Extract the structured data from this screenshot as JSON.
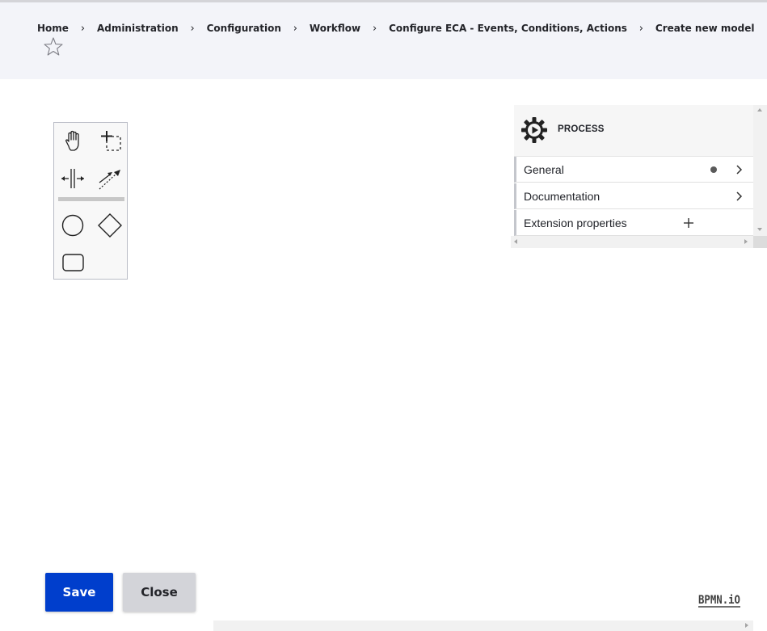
{
  "breadcrumb": {
    "items": [
      "Home",
      "Administration",
      "Configuration",
      "Workflow",
      "Configure ECA - Events, Conditions, Actions",
      "Create new model"
    ],
    "separator": "›"
  },
  "properties_panel": {
    "title": "PROCESS",
    "groups": [
      {
        "label": "General",
        "has_dot": true,
        "action": "chevron-right"
      },
      {
        "label": "Documentation",
        "has_dot": false,
        "action": "chevron-right"
      },
      {
        "label": "Extension properties",
        "has_dot": false,
        "action": "plus"
      }
    ]
  },
  "palette": {
    "tools": [
      "hand-tool-icon",
      "lasso-tool-icon",
      "space-tool-icon",
      "global-connect-tool-icon",
      "start-event-icon",
      "gateway-icon",
      "task-icon"
    ]
  },
  "buttons": {
    "save": "Save",
    "close": "Close"
  },
  "colors": {
    "primary": "#003ecc",
    "header_bg": "#f3f4f9",
    "secondary_button": "#d3d4d9"
  },
  "logo": "BPMN.iO"
}
